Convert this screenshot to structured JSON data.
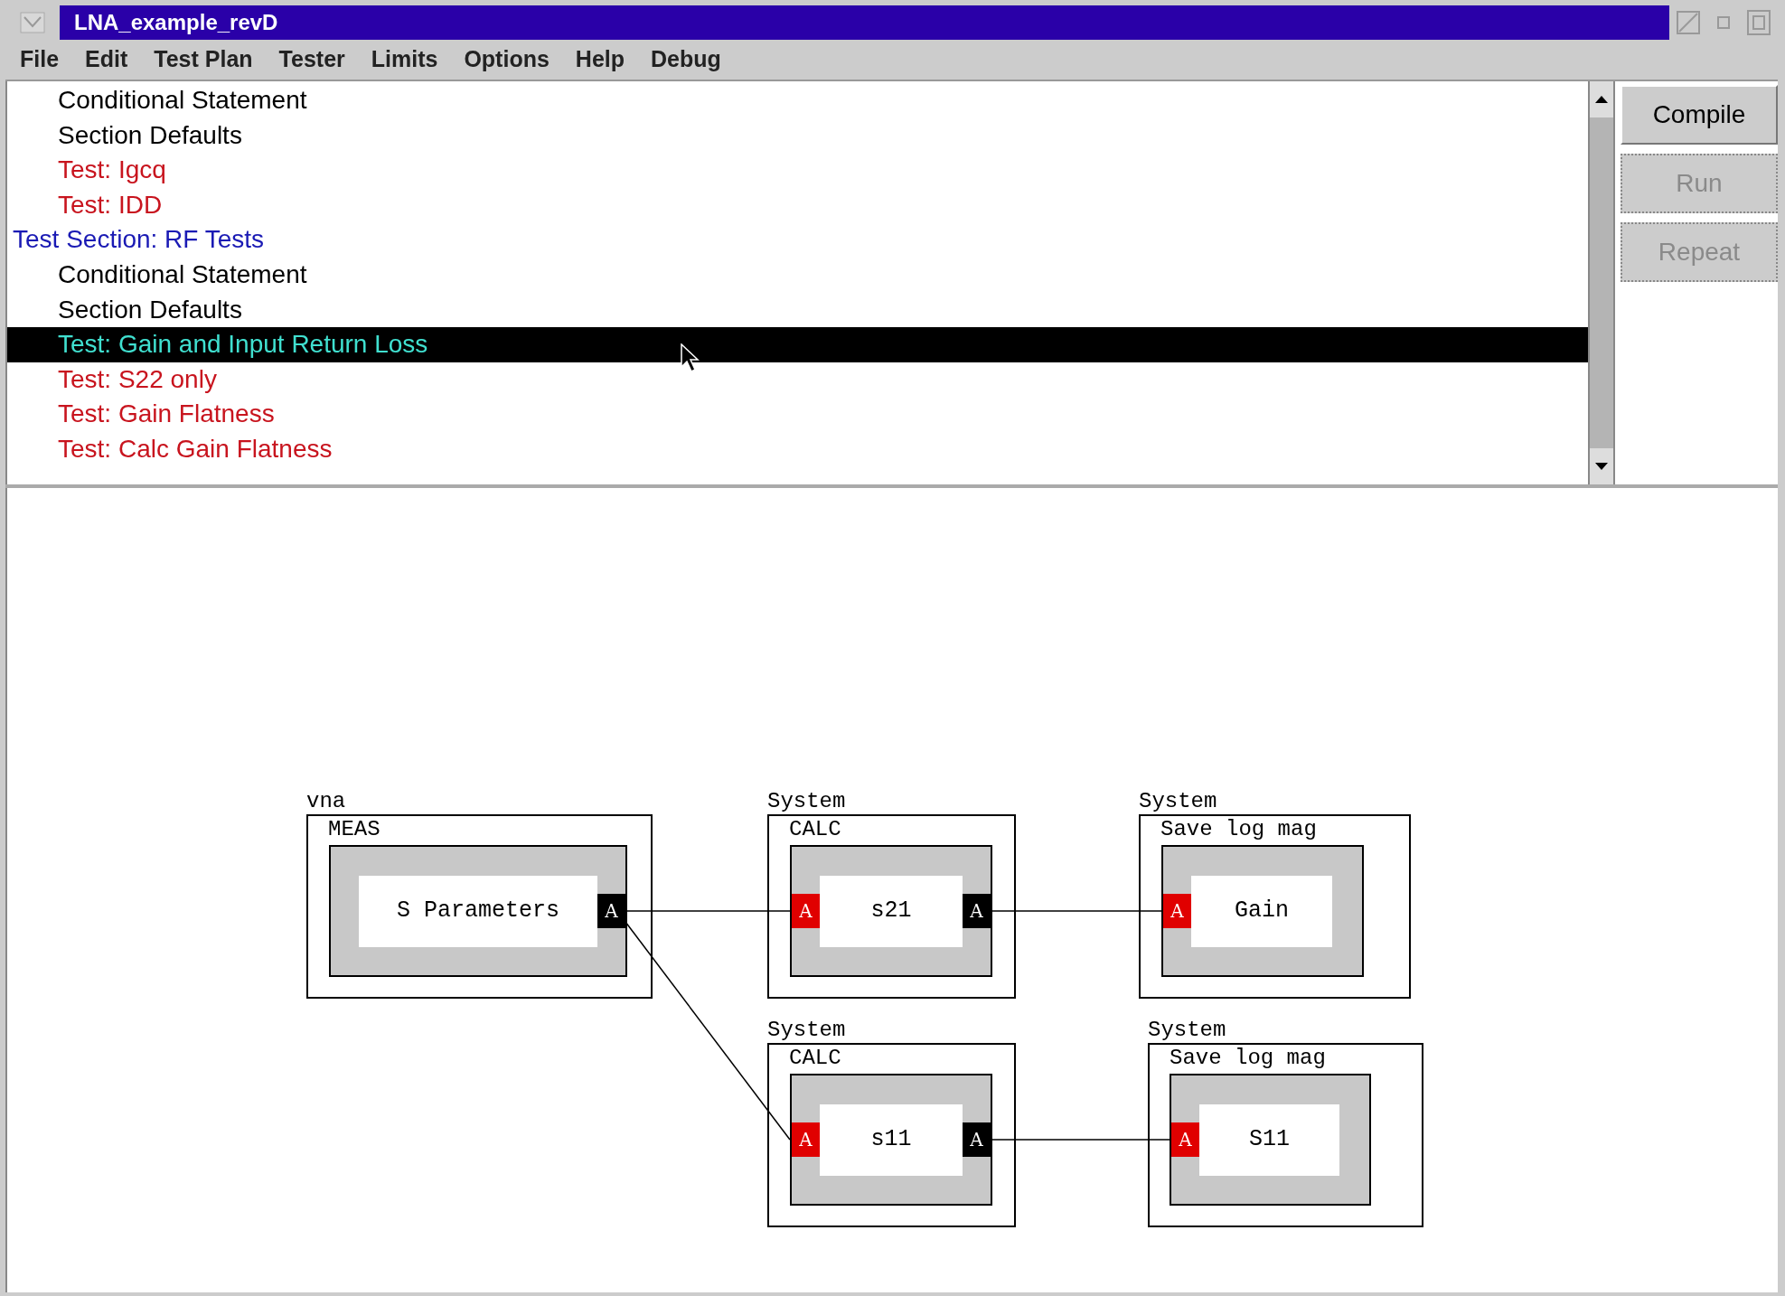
{
  "window": {
    "title": "LNA_example_revD"
  },
  "menu": [
    {
      "label": "File"
    },
    {
      "label": "Edit"
    },
    {
      "label": "Test Plan"
    },
    {
      "label": "Tester"
    },
    {
      "label": "Limits"
    },
    {
      "label": "Options"
    },
    {
      "label": "Help"
    },
    {
      "label": "Debug"
    }
  ],
  "test_plan": [
    {
      "children": [
        {
          "label": "Conditional Statement",
          "kind": "statement",
          "selected": false
        },
        {
          "label": "Section Defaults",
          "kind": "statement",
          "selected": false
        },
        {
          "label": "Test: Igcq",
          "kind": "test",
          "selected": false
        },
        {
          "label": "Test: IDD",
          "kind": "test",
          "selected": false
        }
      ]
    },
    {
      "label": "Test Section: RF Tests",
      "kind": "section",
      "selected": false,
      "children": [
        {
          "label": "Conditional Statement",
          "kind": "statement",
          "selected": false
        },
        {
          "label": "Section Defaults",
          "kind": "statement",
          "selected": false
        },
        {
          "label": "Test: Gain and Input Return Loss",
          "kind": "test",
          "selected": true
        },
        {
          "label": "Test: S22 only",
          "kind": "test",
          "selected": false
        },
        {
          "label": "Test: Gain Flatness",
          "kind": "test",
          "selected": false
        },
        {
          "label": "Test: Calc Gain Flatness",
          "kind": "test",
          "selected": false
        }
      ]
    }
  ],
  "buttons": [
    {
      "label": "Compile",
      "disabled": false
    },
    {
      "label": "Run",
      "disabled": true
    },
    {
      "label": "Repeat",
      "disabled": true
    }
  ],
  "diagram": {
    "nodes": [
      {
        "owner": "vna",
        "block": "MEAS",
        "label": "S Parameters",
        "ports": [
          {
            "kind": "output",
            "label": "A"
          }
        ]
      },
      {
        "owner": "System",
        "block": "CALC",
        "label": "s21",
        "ports": [
          {
            "kind": "input",
            "label": "A"
          },
          {
            "kind": "output",
            "label": "A"
          }
        ]
      },
      {
        "owner": "System",
        "block": "Save log mag",
        "label": "Gain",
        "ports": [
          {
            "kind": "input",
            "label": "A"
          }
        ]
      },
      {
        "owner": "System",
        "block": "CALC",
        "label": "s11",
        "ports": [
          {
            "kind": "input",
            "label": "A"
          },
          {
            "kind": "output",
            "label": "A"
          }
        ]
      },
      {
        "owner": "System",
        "block": "Save log mag",
        "label": "S11",
        "ports": [
          {
            "kind": "input",
            "label": "A"
          }
        ]
      }
    ]
  }
}
